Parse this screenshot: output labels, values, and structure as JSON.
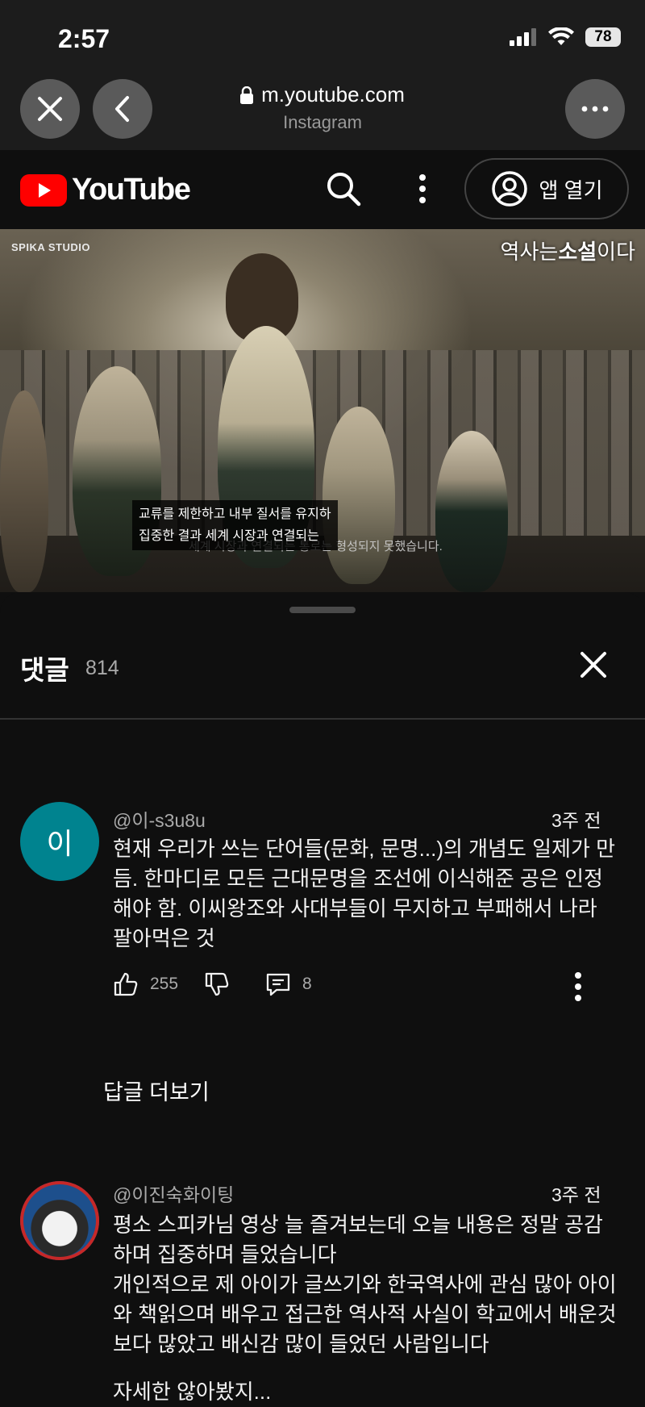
{
  "status_bar": {
    "time": "2:57",
    "battery": "78"
  },
  "browser": {
    "url": "m.youtube.com",
    "source_app": "Instagram"
  },
  "youtube": {
    "logo_text": "YouTube",
    "open_app_label": "앱 열기"
  },
  "video": {
    "watermark": "SPIKA STUDIO",
    "title_overlay_plain": "역사는",
    "title_overlay_bold": "소설",
    "title_overlay_end": "이다",
    "subtitle_line1": "교류를 제한하고 내부 질서를 유지하",
    "subtitle_line2": "집중한 결과 세계 시장과 연결되는",
    "subtitle_faint": "세계 시장과 연결되는 통로는 형성되지 못했습니다."
  },
  "comments_panel": {
    "title": "댓글",
    "count": "814",
    "comments": [
      {
        "author": "@이-s3u8u",
        "avatar_letter": "이",
        "avatar_color": "#00838f",
        "time": "3주 전",
        "text": "현재 우리가 쓰는 단어들(문화, 문명...)의 개념도 일제가 만듬. 한마디로 모든 근대문명을 조선에 이식해준 공은 인정해야 함. 이씨왕조와 사대부들이 무지하고 부패해서 나라 팔아먹은 것",
        "likes": "255",
        "replies": "8",
        "more_replies_label": "답글 더보기"
      },
      {
        "author": "@이진숙화이팅",
        "time": "3주 전",
        "text_line1": "평소 스피카님 영상 늘 즐겨보는데 오늘 내용은 정말 공감하며 집중하며 들었습니다",
        "text_line2": "개인적으로 제 아이가 글쓰기와 한국역사에 관심 많아 아이와 책읽으며 배우고 접근한 역사적 사실이 학교에서 배운것보다 많았고 배신감 많이 들었던 사람입니다",
        "text_line3": "자세한 않아봤지..."
      }
    ]
  },
  "colors": {
    "youtube_red": "#ff0000",
    "background": "#0f0f0f"
  }
}
